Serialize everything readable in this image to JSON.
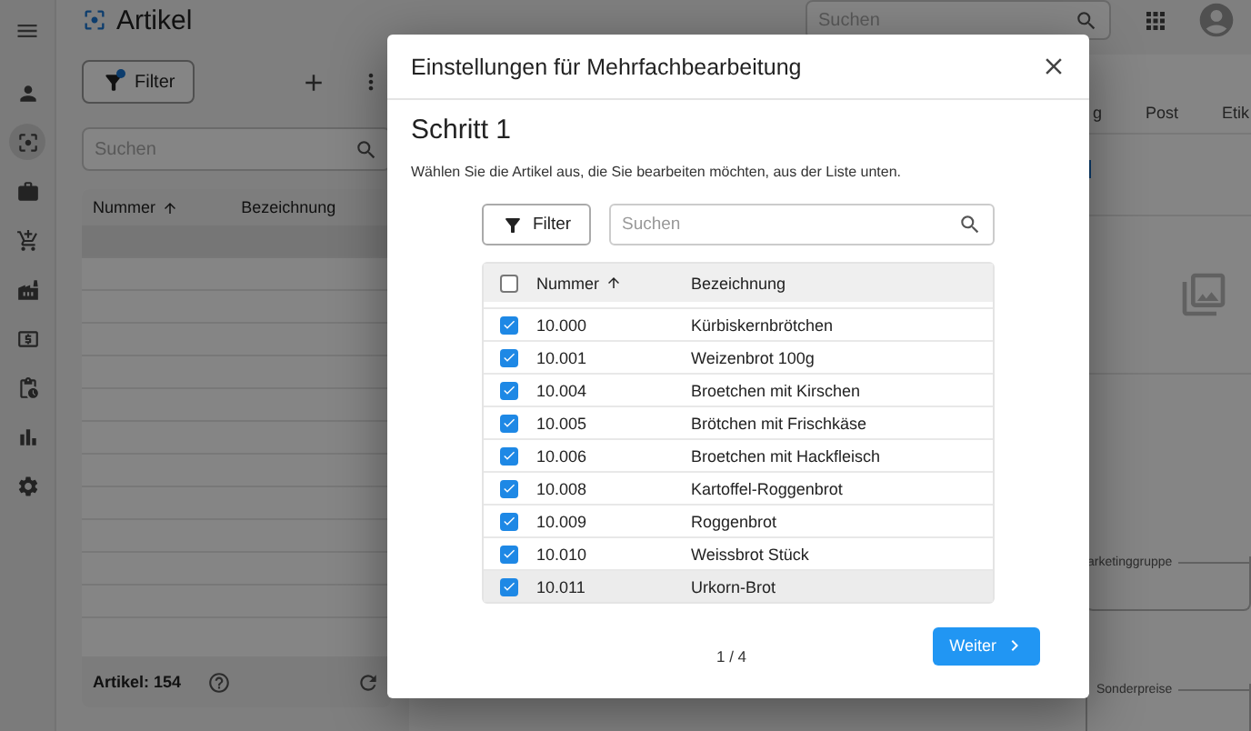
{
  "sidebar": {
    "items": [
      {
        "selected": false
      },
      {
        "selected": true
      },
      {
        "selected": false
      },
      {
        "selected": false
      },
      {
        "selected": false
      },
      {
        "selected": false
      },
      {
        "selected": false
      },
      {
        "selected": false
      },
      {
        "selected": false
      }
    ]
  },
  "header": {
    "title": "Artikel",
    "search_placeholder": "Suchen"
  },
  "list_panel": {
    "filter_label": "Filter",
    "filter_active": true,
    "search_placeholder": "Suchen",
    "columns": [
      {
        "label": "Nummer",
        "sort_ascending": true
      },
      {
        "label": "Bezeichnung",
        "sort_ascending": false
      }
    ],
    "count": "Artikel: 154"
  },
  "detail_panel": {
    "tabs": [
      {
        "label": "g",
        "selected": false
      },
      {
        "label": "Post",
        "selected": false
      },
      {
        "label": "Etik",
        "selected": false
      }
    ],
    "fields": [
      {
        "label": "arketinggruppe"
      },
      {
        "label": "Sonderpreise"
      }
    ]
  },
  "dialog": {
    "title": "Einstellungen für Mehrfachbearbeitung",
    "step_title": "Schritt 1",
    "description": "Wählen Sie die Artikel aus, die Sie bearbeiten möchten, aus der Liste unten.",
    "filter_label": "Filter",
    "search_placeholder": "Suchen",
    "all_checked": false,
    "columns": [
      {
        "label": "Nummer",
        "sort_ascending": true
      },
      {
        "label": "Bezeichnung",
        "sort_ascending": false
      }
    ],
    "rows": [
      {
        "number": "10.000",
        "name": "Kürbiskernbrötchen",
        "checked": true,
        "selected": false
      },
      {
        "number": "10.001",
        "name": "Weizenbrot 100g",
        "checked": true,
        "selected": false
      },
      {
        "number": "10.004",
        "name": "Broetchen mit Kirschen",
        "checked": true,
        "selected": false
      },
      {
        "number": "10.005",
        "name": "Brötchen mit Frischkäse",
        "checked": true,
        "selected": false
      },
      {
        "number": "10.006",
        "name": "Broetchen mit Hackfleisch",
        "checked": true,
        "selected": false
      },
      {
        "number": "10.008",
        "name": "Kartoffel-Roggenbrot",
        "checked": true,
        "selected": false
      },
      {
        "number": "10.009",
        "name": "Roggenbrot",
        "checked": true,
        "selected": false
      },
      {
        "number": "10.010",
        "name": "Weissbrot Stück",
        "checked": true,
        "selected": false
      },
      {
        "number": "10.011",
        "name": "Urkorn-Brot",
        "checked": true,
        "selected": true
      }
    ],
    "pager": "1 / 4",
    "next_label": "Weiter"
  }
}
